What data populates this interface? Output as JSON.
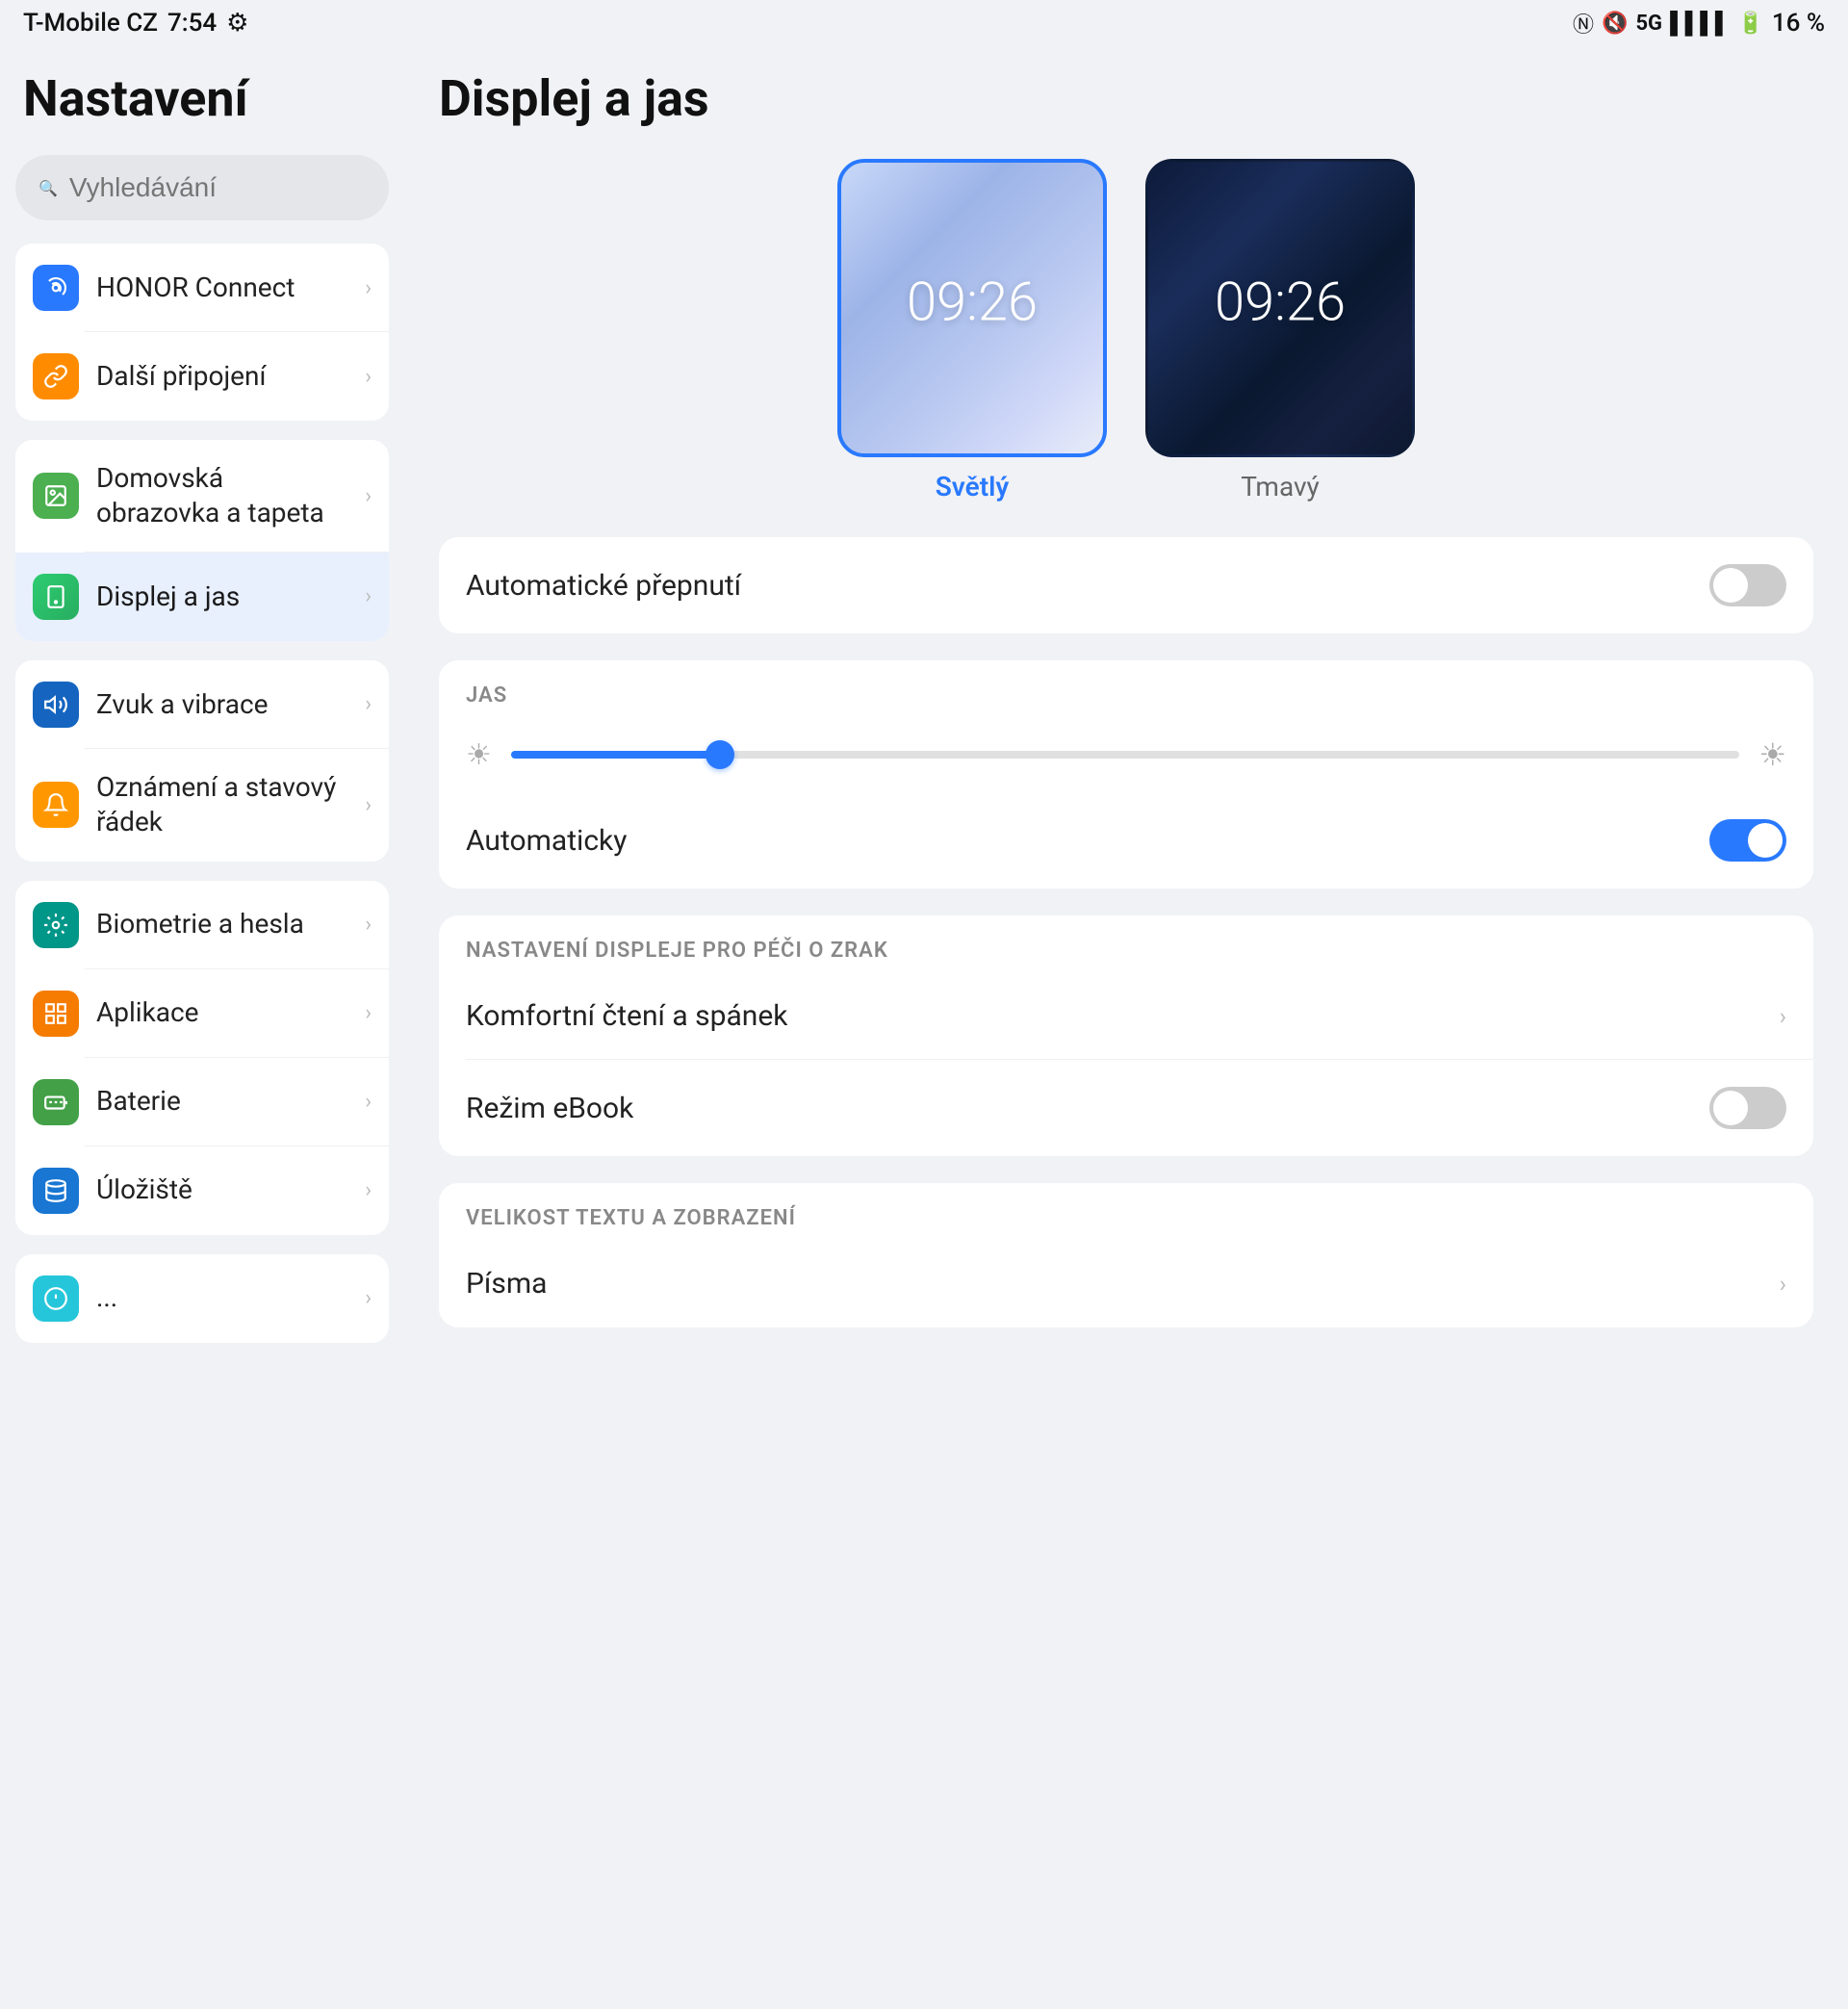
{
  "statusBar": {
    "carrier": "T-Mobile CZ",
    "time": "7:54",
    "battery": "16 %",
    "icons": [
      "nfc",
      "mute",
      "signal",
      "battery"
    ]
  },
  "leftPanel": {
    "title": "Nastavení",
    "search": {
      "placeholder": "Vyhledávání"
    },
    "groups": [
      {
        "items": [
          {
            "id": "honor-connect",
            "icon": "wifi-icon",
            "iconColor": "icon-blue",
            "iconSymbol": "📡",
            "label": "HONOR Connect",
            "active": false
          },
          {
            "id": "dalsi-pripojeni",
            "icon": "link-icon",
            "iconColor": "icon-orange",
            "iconSymbol": "🔗",
            "label": "Další připojení",
            "active": false
          }
        ]
      },
      {
        "items": [
          {
            "id": "domovska-obrazovka",
            "icon": "image-icon",
            "iconColor": "icon-green-light",
            "iconSymbol": "🖼",
            "label": "Domovská obrazovka a tapeta",
            "active": false
          },
          {
            "id": "displej-a-jas",
            "icon": "display-icon",
            "iconColor": "icon-green-dark",
            "iconSymbol": "📱",
            "label": "Displej a jas",
            "active": true
          }
        ]
      },
      {
        "items": [
          {
            "id": "zvuk-a-vibrace",
            "icon": "sound-icon",
            "iconColor": "icon-blue-dark",
            "iconSymbol": "🔊",
            "label": "Zvuk a vibrace",
            "active": false
          },
          {
            "id": "oznameni",
            "icon": "bell-icon",
            "iconColor": "icon-amber",
            "iconSymbol": "🔔",
            "label": "Oznámení a stavový řádek",
            "active": false
          }
        ]
      },
      {
        "items": [
          {
            "id": "biometrie",
            "icon": "key-icon",
            "iconColor": "icon-teal",
            "iconSymbol": "🔑",
            "label": "Biometrie a hesla",
            "active": false
          },
          {
            "id": "aplikace",
            "icon": "apps-icon",
            "iconColor": "icon-orange2",
            "iconSymbol": "⊞",
            "label": "Aplikace",
            "active": false
          },
          {
            "id": "baterie",
            "icon": "battery-icon",
            "iconColor": "icon-green2",
            "iconSymbol": "🔋",
            "label": "Baterie",
            "active": false
          },
          {
            "id": "uloziste",
            "icon": "storage-icon",
            "iconColor": "icon-blue3",
            "iconSymbol": "💾",
            "label": "Úložiště",
            "active": false
          }
        ]
      }
    ]
  },
  "rightPanel": {
    "title": "Displej a jas",
    "themes": [
      {
        "id": "svetly",
        "label": "Světlý",
        "time": "09:26",
        "selected": true
      },
      {
        "id": "tmavy",
        "label": "Tmavý",
        "time": "09:26",
        "selected": false
      }
    ],
    "automaticSwitch": {
      "label": "Automatické přepnutí",
      "enabled": false
    },
    "brightness": {
      "sectionLabel": "JAS",
      "autoLabel": "Automaticky",
      "autoEnabled": true,
      "value": 18
    },
    "eyeCare": {
      "sectionLabel": "NASTAVENÍ DISPLEJE PRO PÉČI O ZRAK",
      "items": [
        {
          "id": "komfortni-cteni",
          "label": "Komfortní čtení a spánek",
          "type": "link"
        },
        {
          "id": "rezim-ebook",
          "label": "Režim eBook",
          "type": "toggle",
          "enabled": false
        }
      ]
    },
    "textSize": {
      "sectionLabel": "VELIKOST TEXTU A ZOBRAZENÍ",
      "items": [
        {
          "id": "pisma",
          "label": "Písma",
          "type": "link"
        }
      ]
    }
  }
}
